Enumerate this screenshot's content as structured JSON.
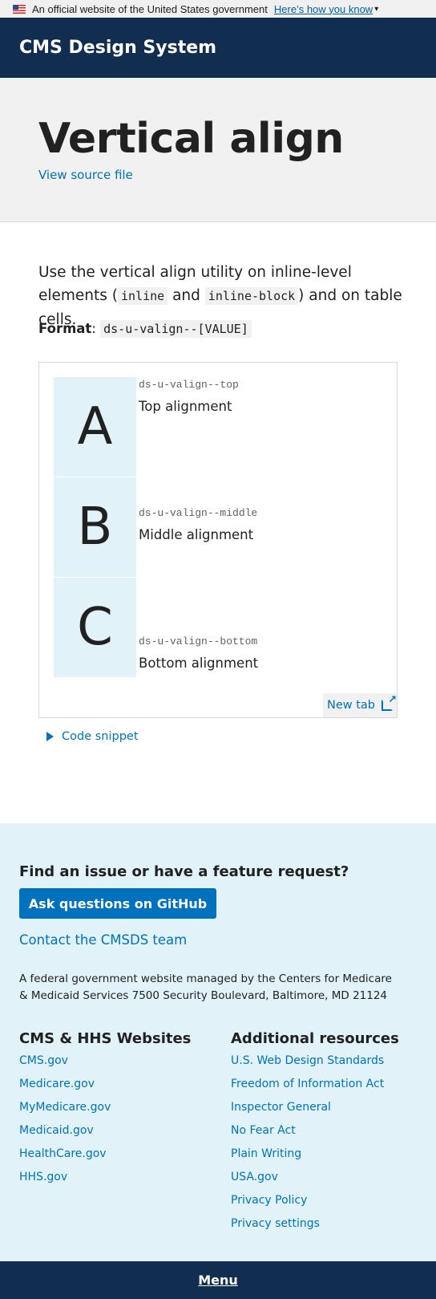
{
  "gov_banner": {
    "text": "An official website of the United States government",
    "link": "Here’s how you know"
  },
  "header": {
    "title": "CMS Design System"
  },
  "hero": {
    "title": "Vertical align",
    "source_link": "View source file"
  },
  "content": {
    "lead_1": "Use the vertical align utility on inline-level elements (",
    "code_inline": "inline",
    "lead_and": " and ",
    "code_inline_block": "inline-block",
    "lead_2": ") and on table cells.",
    "format_label": "Format",
    "format_code": "ds-u-valign--[VALUE]"
  },
  "example": {
    "rows": [
      {
        "letter": "A",
        "class": "ds-u-valign--top",
        "label": "Top alignment"
      },
      {
        "letter": "B",
        "class": "ds-u-valign--middle",
        "label": "Middle alignment"
      },
      {
        "letter": "C",
        "class": "ds-u-valign--bottom",
        "label": "Bottom alignment"
      }
    ],
    "new_tab": "New tab"
  },
  "snippet": {
    "label": "Code snippet"
  },
  "footer": {
    "heading": "Find an issue or have a feature request?",
    "github_button": "Ask questions on GitHub",
    "contact": "Contact the CMSDS team",
    "address": "A federal government website managed by the Centers for Medicare & Medicaid Services 7500 Security Boulevard, Baltimore, MD 21124",
    "col1_title": "CMS & HHS Websites",
    "col1_links": [
      "CMS.gov",
      "Medicare.gov",
      "MyMedicare.gov",
      "Medicaid.gov",
      "HealthCare.gov",
      "HHS.gov"
    ],
    "col2_title": "Additional resources",
    "col2_links": [
      "U.S. Web Design Standards",
      "Freedom of Information Act",
      "Inspector General",
      "No Fear Act",
      "Plain Writing",
      "USA.gov",
      "Privacy Policy",
      "Privacy settings"
    ]
  },
  "menu": {
    "label": "Menu"
  },
  "colors": {
    "navy": "#112e51",
    "primary": "#0071bc",
    "light_blue": "#e1f3f8",
    "gray_bg": "#f1f1f1"
  }
}
